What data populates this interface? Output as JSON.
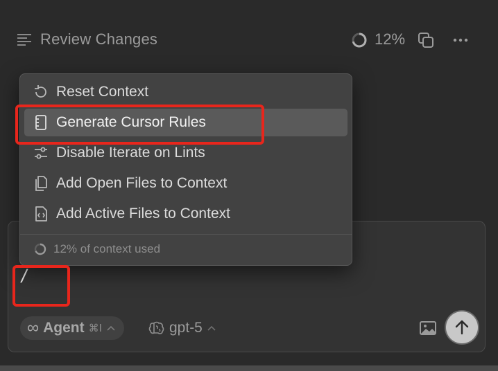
{
  "header": {
    "title": "Review Changes",
    "context_percent": "12%",
    "icons": [
      "review-list-icon",
      "progress-ring-icon",
      "copy-icon",
      "more-horizontal-icon"
    ]
  },
  "menu": {
    "items": [
      {
        "label": "Reset Context",
        "icon": "reset-icon",
        "selected": false
      },
      {
        "label": "Generate Cursor Rules",
        "icon": "rules-file-icon",
        "selected": true
      },
      {
        "label": "Disable Iterate on Lints",
        "icon": "sliders-icon",
        "selected": false
      },
      {
        "label": "Add Open Files to Context",
        "icon": "files-icon",
        "selected": false
      },
      {
        "label": "Add Active Files to Context",
        "icon": "code-file-icon",
        "selected": false
      }
    ],
    "footer_label": "12% of context used"
  },
  "composer": {
    "input_value": "/",
    "agent": {
      "label": "Agent",
      "shortcut": "⌘I"
    },
    "model": {
      "label": "gpt-5"
    }
  },
  "colors": {
    "background": "#2a2a2a",
    "menu_background": "#424242",
    "selected_item": "#5a5a5a",
    "annotation_red": "#e8261c",
    "send_button": "#c8c8c8"
  }
}
